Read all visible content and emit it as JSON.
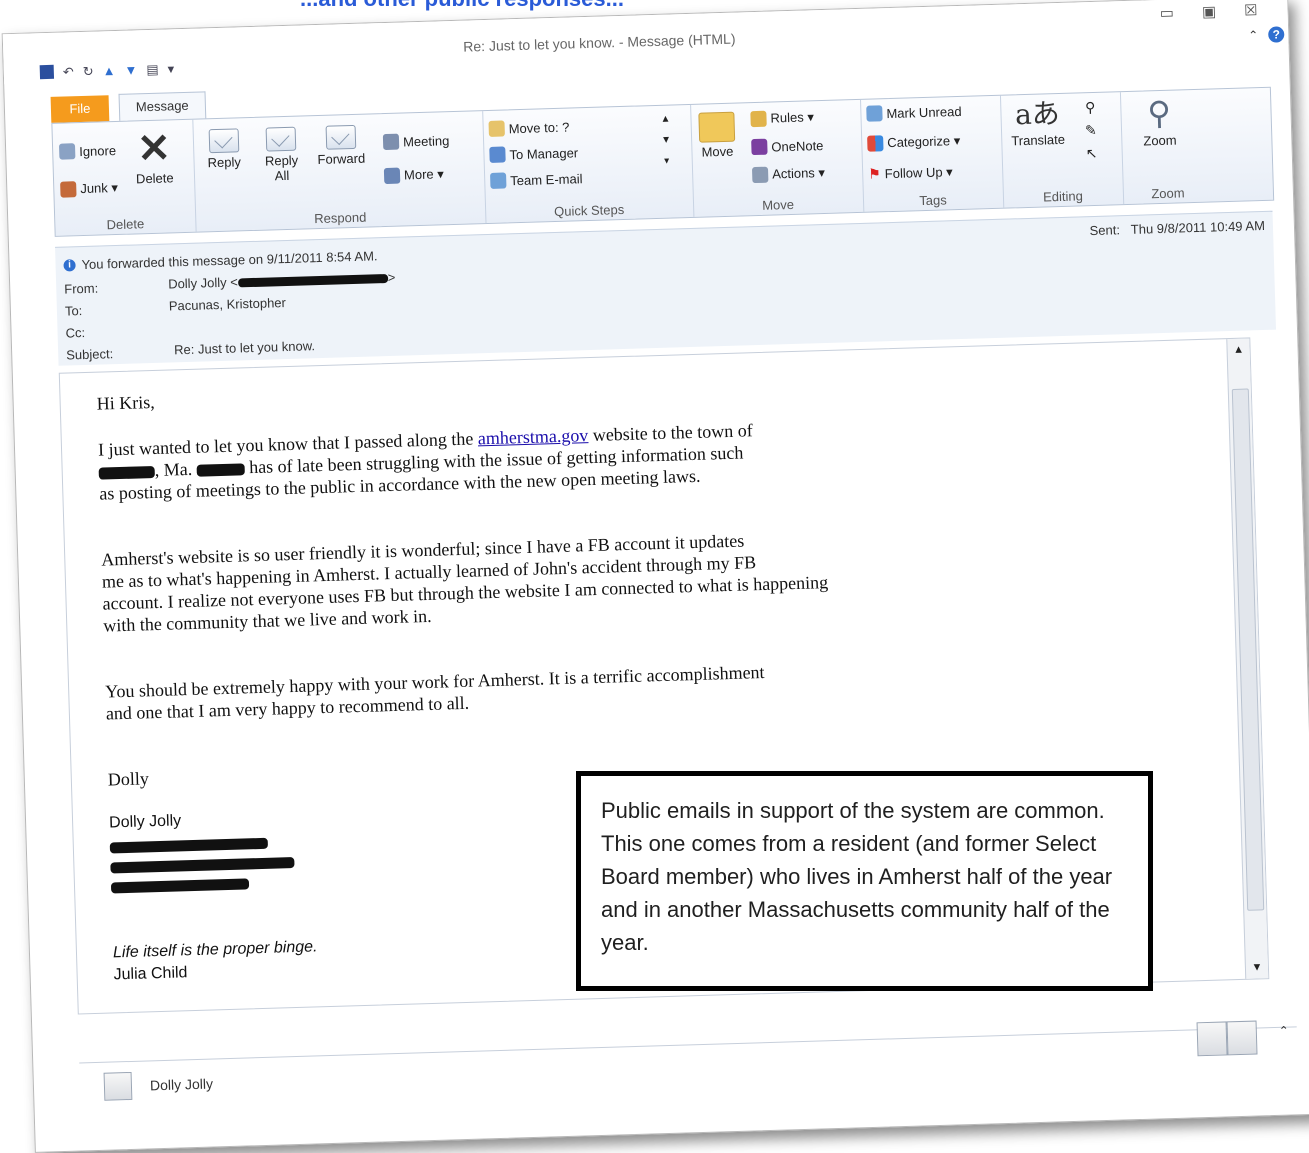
{
  "heading": {
    "text": "...and other public responses..."
  },
  "window": {
    "title": "Re: Just to let you know. - Message (HTML)",
    "controls": {
      "minimize": "▭",
      "maximize": "▣",
      "close": "☒"
    }
  },
  "tabs": {
    "file": "File",
    "message": "Message"
  },
  "ribbon": {
    "delete_group": {
      "label": "Delete",
      "ignore": "Ignore",
      "junk": "Junk ▾",
      "delete": "Delete"
    },
    "respond_group": {
      "label": "Respond",
      "reply": "Reply",
      "reply_all": "Reply All",
      "forward": "Forward",
      "meeting": "Meeting",
      "more": "More ▾"
    },
    "quicksteps_group": {
      "label": "Quick Steps",
      "move_to": "Move to: ?",
      "to_manager": "To Manager",
      "team_email": "Team E-mail"
    },
    "move_group": {
      "label": "Move",
      "move": "Move",
      "rules": "Rules ▾",
      "onenote": "OneNote",
      "actions": "Actions ▾"
    },
    "tags_group": {
      "label": "Tags",
      "mark_unread": "Mark Unread",
      "categorize": "Categorize ▾",
      "follow_up": "Follow Up ▾"
    },
    "editing_group": {
      "label": "Editing",
      "translate": "Translate"
    },
    "zoom_group": {
      "label": "Zoom",
      "zoom": "Zoom"
    }
  },
  "headers": {
    "info": "You forwarded this message on 9/11/2011 8:54 AM.",
    "sent_label": "Sent:",
    "sent_value": "Thu 9/8/2011 10:49 AM",
    "from_label": "From:",
    "from_value": "Dolly Jolly <",
    "to_label": "To:",
    "to_value": "Pacunas, Kristopher",
    "cc_label": "Cc:",
    "subject_label": "Subject:",
    "subject_value": "Re: Just to let you know."
  },
  "body": {
    "greeting": "Hi Kris,",
    "p1_before": "I just wanted to let you know that I passed along the ",
    "p1_link": "amherstma.gov",
    "p1_after": " website to the town of",
    "p1_line2a": ", Ma. ",
    "p1_line2b": " has of late been struggling with the issue of getting information such",
    "p1_line3": "as posting of meetings to the public in accordance with the new open meeting laws.",
    "p2_line1": "Amherst's website is so user friendly it is wonderful; since I have a FB account it updates",
    "p2_line2": "me as to what's happening in Amherst.  I actually learned of John's accident through my FB",
    "p2_line3": "account.  I realize not everyone uses FB but through the website I am connected to what is happening",
    "p2_line4": "with the community that we live and work in.",
    "p3_line1": "You should be extremely happy with your work for Amherst.  It is a terrific accomplishment",
    "p3_line2": "and one that I am very happy to recommend to all.",
    "closing": "Dolly",
    "sig_name": "Dolly Jolly",
    "quote": "Life itself is the proper binge.",
    "quote_author": "Julia Child"
  },
  "people_bar": {
    "name": "Dolly Jolly"
  },
  "callout": {
    "text": "Public emails in support of the system are common. This one comes from a resident (and former Select Board member) who lives in Amherst half of the year and in another Massachusetts community half of the year."
  },
  "colors": {
    "file_tab": "#f59b1d",
    "link": "#1a0dab",
    "ribbon_bg": "#e8eef7"
  }
}
